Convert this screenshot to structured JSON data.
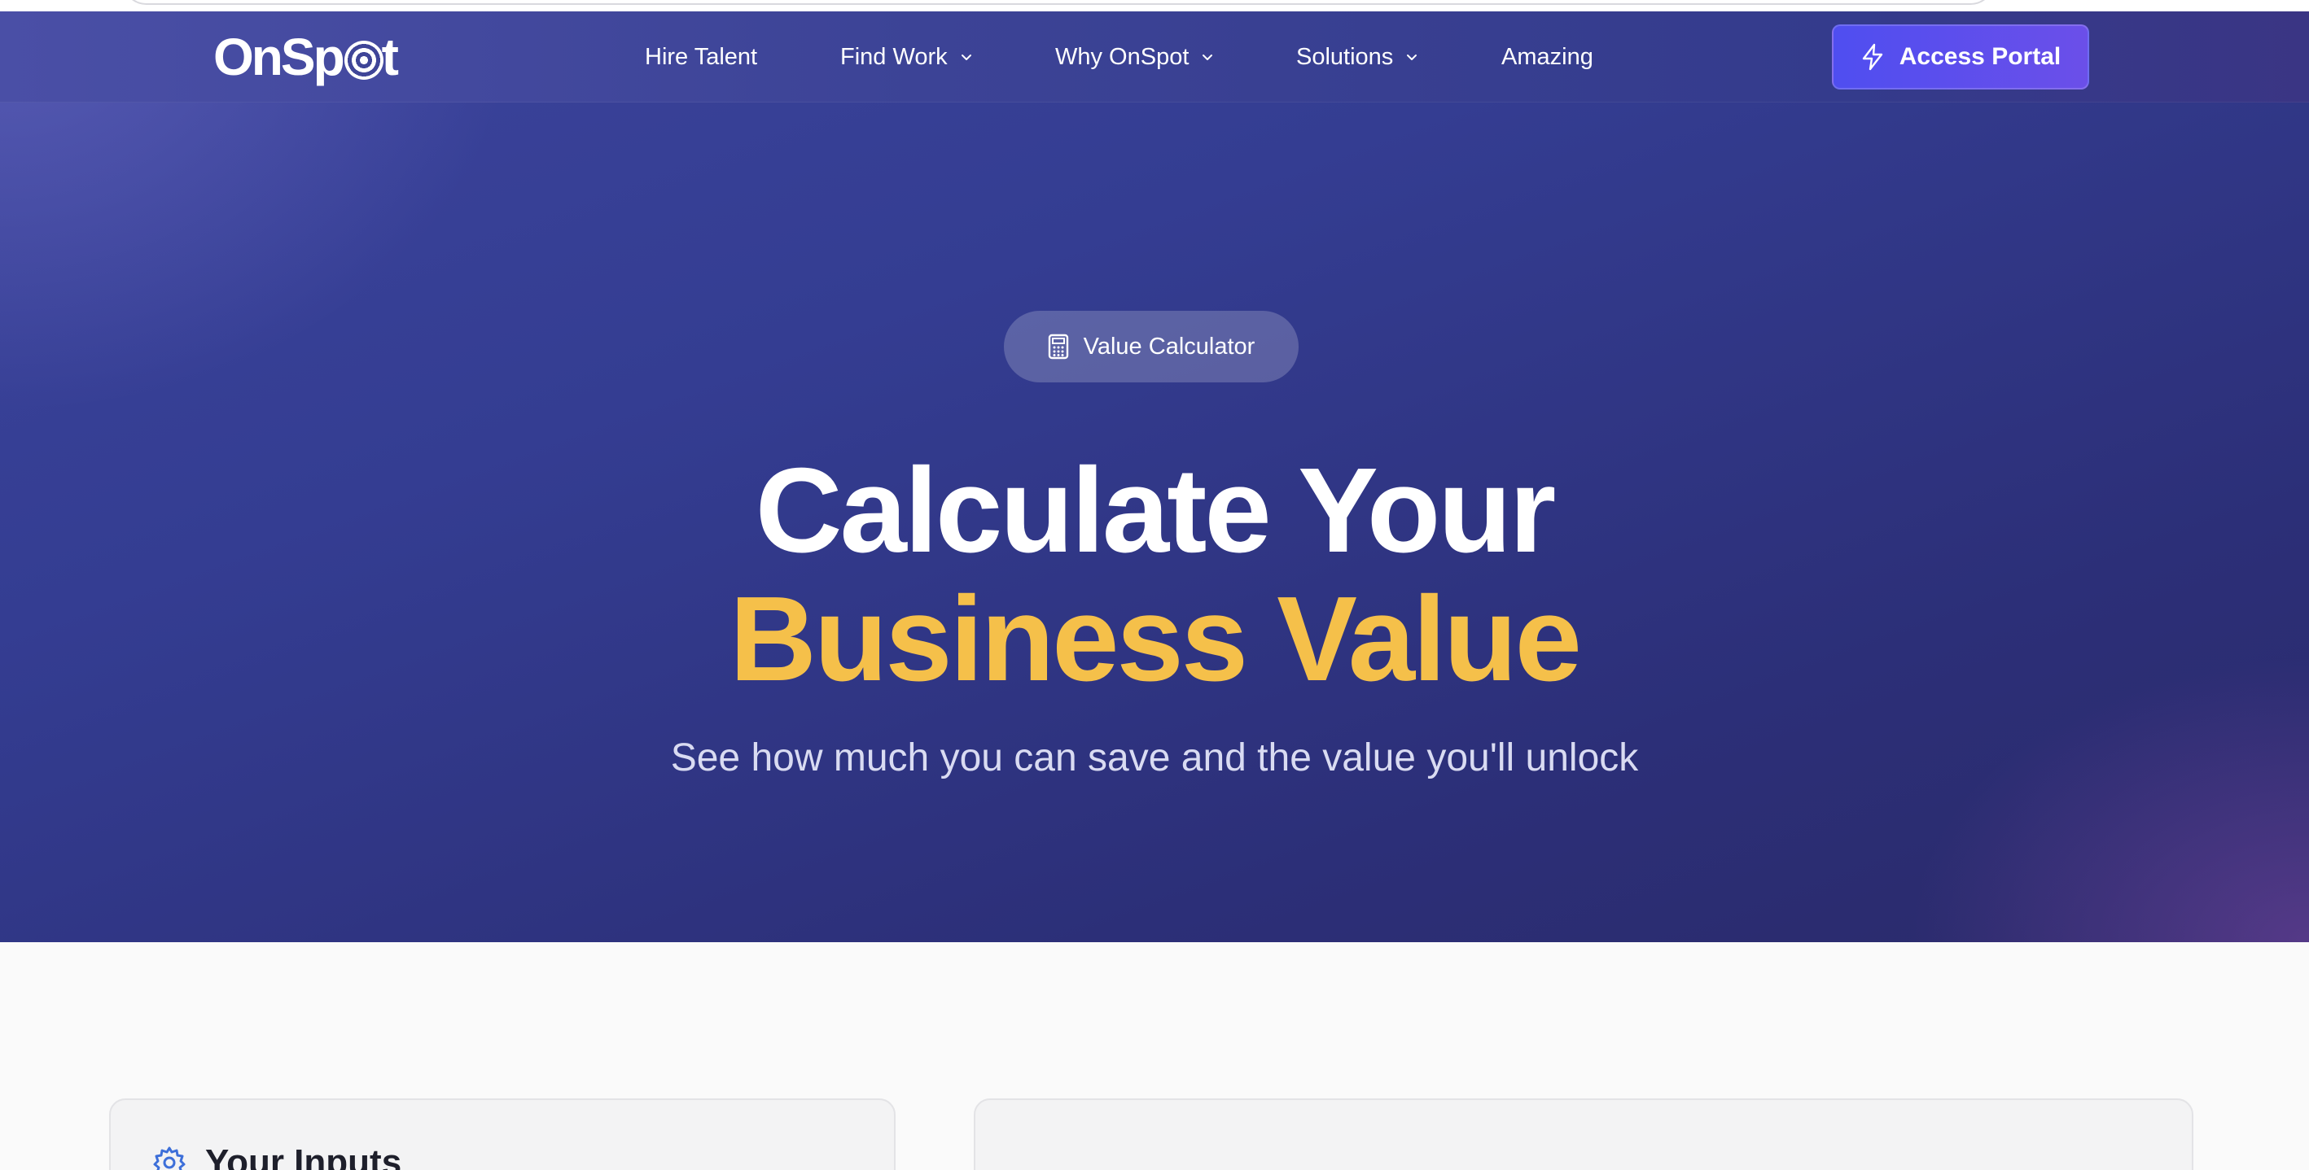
{
  "brand": {
    "name": "OnSpot"
  },
  "nav": {
    "items": [
      {
        "label": "Hire Talent",
        "dropdown": false
      },
      {
        "label": "Find Work",
        "dropdown": true
      },
      {
        "label": "Why OnSpot",
        "dropdown": true
      },
      {
        "label": "Solutions",
        "dropdown": true
      },
      {
        "label": "Amazing",
        "dropdown": false
      }
    ],
    "cta": {
      "label": "Access Portal",
      "icon": "lightning-icon"
    }
  },
  "hero": {
    "badge": {
      "label": "Value Calculator",
      "icon": "calculator-icon"
    },
    "title_line1": "Calculate Your",
    "title_line2": "Business Value",
    "subtitle": "See how much you can save and the value you'll unlock"
  },
  "inputs_card": {
    "title": "Your Inputs",
    "icon": "gear-icon"
  },
  "colors": {
    "hero_bg": "#343d92",
    "accent_yellow": "#f5c04a",
    "cta_start": "#4f4ef0",
    "cta_end": "#6b4fe9",
    "page_bg": "#fafafa"
  }
}
